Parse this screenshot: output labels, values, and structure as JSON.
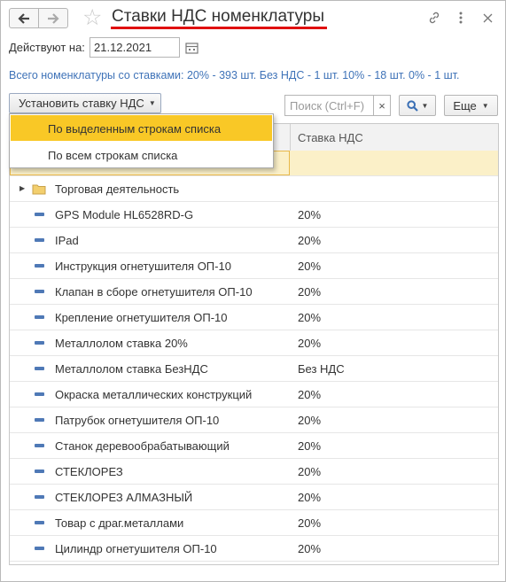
{
  "window": {
    "title": "Ставки НДС номенклатуры",
    "back_icon": "arrow-left-icon",
    "forward_icon": "arrow-right-icon",
    "favorite_icon": "star-icon",
    "link_icon": "link-icon",
    "menu_icon": "more-vertical-icon",
    "close_icon": "close-icon"
  },
  "filter": {
    "date_label": "Действуют на:",
    "date_value": "21.12.2021",
    "calendar_icon": "calendar-icon"
  },
  "summary": "Всего номенклатуры со ставками: 20% - 393 шт. Без НДС - 1 шт. 10% - 18 шт. 0% - 1 шт.",
  "toolbar": {
    "set_vat_label": "Установить ставку НДС",
    "search_placeholder": "Поиск (Ctrl+F)",
    "search_clear": "×",
    "more_label": "Еще"
  },
  "menu": {
    "items": [
      {
        "label": "По выделенным строкам списка",
        "active": true
      },
      {
        "label": "По всем строкам списка",
        "active": false
      }
    ]
  },
  "table": {
    "columns": [
      "",
      "Ставка НДС"
    ],
    "group_row": {
      "name": "Торговая деятельность"
    },
    "rows": [
      {
        "name": "GPS Module HL6528RD-G",
        "vat": "20%"
      },
      {
        "name": "IPad",
        "vat": "20%"
      },
      {
        "name": "Инструкция огнетушителя ОП-10",
        "vat": "20%"
      },
      {
        "name": "Клапан в сборе огнетушителя ОП-10",
        "vat": "20%"
      },
      {
        "name": "Крепление огнетушителя ОП-10",
        "vat": "20%"
      },
      {
        "name": "Металлолом ставка 20%",
        "vat": "20%"
      },
      {
        "name": "Металлолом ставка БезНДС",
        "vat": "Без НДС"
      },
      {
        "name": "Окраска металлических конструкций",
        "vat": "20%"
      },
      {
        "name": "Патрубок огнетушителя ОП-10",
        "vat": "20%"
      },
      {
        "name": "Станок деревообрабатывающий",
        "vat": "20%"
      },
      {
        "name": "СТЕКЛОРЕЗ",
        "vat": "20%"
      },
      {
        "name": "СТЕКЛОРЕЗ АЛМАЗНЫЙ",
        "vat": "20%"
      },
      {
        "name": "Товар с драг.металлами",
        "vat": "20%"
      },
      {
        "name": "Цилиндр огнетушителя ОП-10",
        "vat": "20%"
      }
    ]
  },
  "colors": {
    "accent_underline": "#e01010",
    "summary_link": "#3f73b8",
    "menu_highlight": "#f9c826",
    "selected_row": "#fbf0c8",
    "item_marker": "#4f79b6"
  }
}
